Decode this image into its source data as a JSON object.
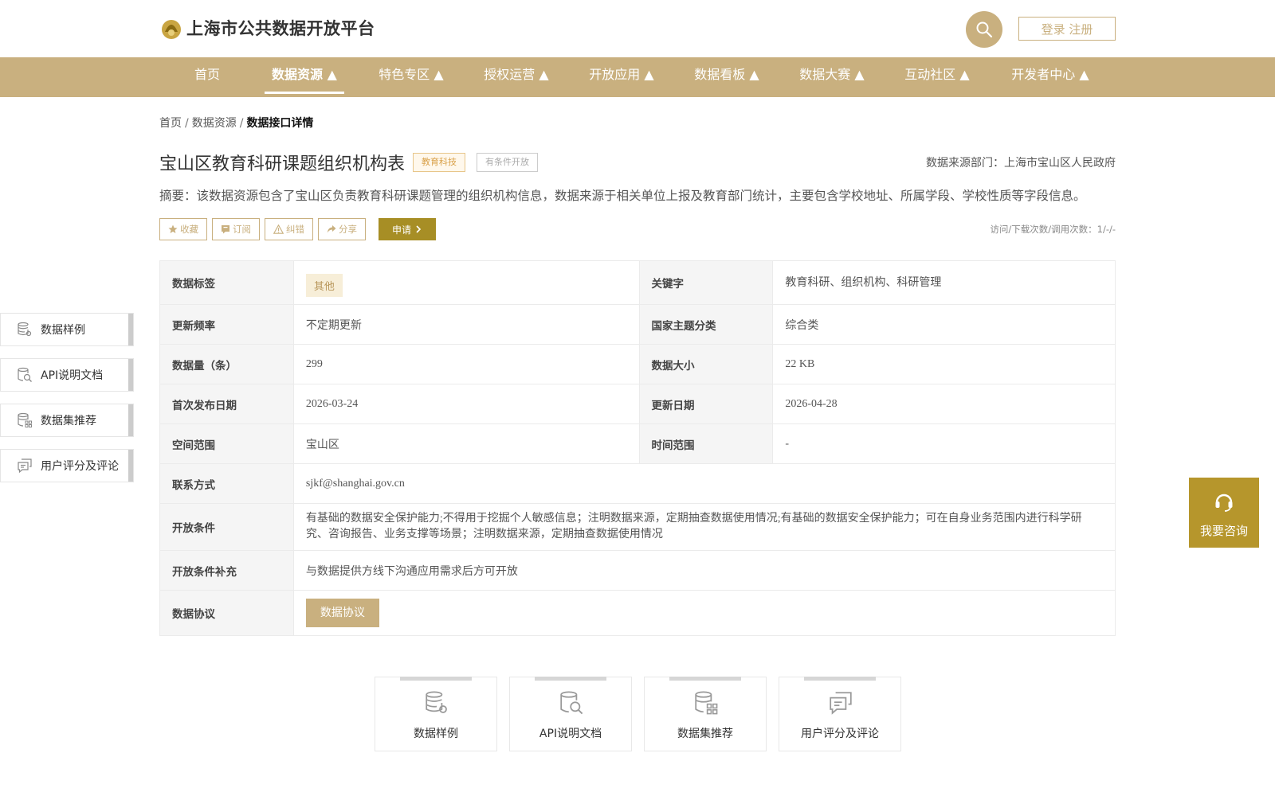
{
  "header": {
    "site_title": "上海市公共数据开放平台",
    "login_label": "登录 注册",
    "icons": {
      "logo": "shanghai-city-emblem",
      "search": "search-icon"
    },
    "colors": {
      "brand": "#c9b07f",
      "primary_button": "#a78e25",
      "consult": "#b6962c"
    }
  },
  "nav": {
    "items": [
      {
        "label": "首页"
      },
      {
        "label": "数据资源 ▲",
        "active": true
      },
      {
        "label": "特色专区 ▲"
      },
      {
        "label": "授权运营 ▲"
      },
      {
        "label": "开放应用 ▲"
      },
      {
        "label": "数据看板 ▲"
      },
      {
        "label": "数据大赛 ▲"
      },
      {
        "label": "互动社区 ▲"
      },
      {
        "label": "开发者中心 ▲"
      }
    ]
  },
  "breadcrumb": {
    "items": [
      "首页",
      "数据资源",
      "数据接口详情"
    ],
    "separator": "/"
  },
  "dataset": {
    "title": "宝山区教育科研课题组织机构表",
    "category_tag": "教育科技",
    "open_tag": "有条件开放",
    "source_dept": "数据来源部门：上海市宝山区人民政府",
    "summary": "摘要：该数据资源包含了宝山区负责教育科研课题管理的组织机构信息，数据来源于相关单位上报及教育部门统计，主要包含学校地址、所属学段、学校性质等字段信息。",
    "stats": "访问/下载次数/调用次数：1/-/-"
  },
  "actions": {
    "favorite": "收藏",
    "subscribe": "订阅",
    "report": "纠错",
    "share": "分享",
    "apply": "申请"
  },
  "table": {
    "tag_label": "数据标签",
    "tag_value": "其他",
    "keyword_label": "关键字",
    "keyword_value": "教育科研、组织机构、科研管理",
    "freq_label": "更新频率",
    "freq_value": "不定期更新",
    "theme_label": "国家主题分类",
    "theme_value": "综合类",
    "count_label": "数据量（条）",
    "count_value": "299",
    "size_label": "数据大小",
    "size_value": "22 KB",
    "first_label": "首次发布日期",
    "first_value": "2026-03-24",
    "update_label": "更新日期",
    "update_value": "2026-04-28",
    "space_label": "空间范围",
    "space_value": "宝山区",
    "time_label": "时间范围",
    "time_value": "-",
    "contact_label": "联系方式",
    "contact_value": "sjkf@shanghai.gov.cn",
    "cond_label": "开放条件",
    "cond_value": "有基础的数据安全保护能力;不得用于挖掘个人敏感信息；注明数据来源，定期抽查数据使用情况;有基础的数据安全保护能力；可在自身业务范围内进行科学研究、咨询报告、业务支撑等场景；注明数据来源，定期抽查数据使用情况",
    "cond_extra_label": "开放条件补充",
    "cond_extra_value": "与数据提供方线下沟通应用需求后方可开放",
    "protocol_label": "数据协议",
    "protocol_button": "数据协议"
  },
  "side_nav": [
    {
      "label": "数据样例",
      "icon": "database-gear-icon"
    },
    {
      "label": "API说明文档",
      "icon": "document-search-icon"
    },
    {
      "label": "数据集推荐",
      "icon": "database-grid-icon"
    },
    {
      "label": "用户评分及评论",
      "icon": "comment-icon"
    }
  ],
  "cards": [
    {
      "label": "数据样例",
      "icon": "database-gear-icon"
    },
    {
      "label": "API说明文档",
      "icon": "document-search-icon"
    },
    {
      "label": "数据集推荐",
      "icon": "database-grid-icon"
    },
    {
      "label": "用户评分及评论",
      "icon": "comment-icon"
    }
  ],
  "consult": {
    "label": "我要咨询",
    "icon": "headset-icon"
  }
}
